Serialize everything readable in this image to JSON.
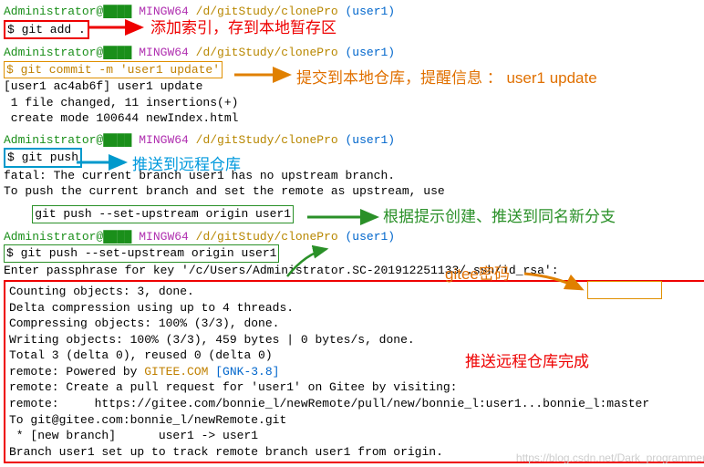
{
  "prompt": {
    "user": "Administrator@",
    "host": " MINGW64 ",
    "path": "/d/gitStudy/clonePro ",
    "branch": "(user1)",
    "blocked": "████"
  },
  "cmd": {
    "add": "$ git add .",
    "commit": "$ git commit -m 'user1 update'",
    "push": "$ git push",
    "setup": "git push --set-upstream origin user1",
    "setup2": "$ git push --set-upstream origin user1"
  },
  "out": {
    "commit1": "[user1 ac4ab6f] user1 update",
    "commit2": " 1 file changed, 11 insertions(+)",
    "commit3": " create mode 100644 newIndex.html",
    "push1": "fatal: The current branch user1 has no upstream branch.",
    "push2": "To push the current branch and set the remote as upstream, use",
    "pass": "Enter passphrase for key '/c/Users/Administrator.SC-201912251133/.ssh/id_rsa':",
    "r1": "Counting objects: 3, done.",
    "r2": "Delta compression using up to 4 threads.",
    "r3": "Compressing objects: 100% (3/3), done.",
    "r4": "Writing objects: 100% (3/3), 459 bytes | 0 bytes/s, done.",
    "r5": "Total 3 (delta 0), reused 0 (delta 0)",
    "r6a": "remote: Powered by ",
    "r6b": "GITEE.COM ",
    "r6c": "[GNK-3.8]",
    "r7": "remote: Create a pull request for 'user1' on Gitee by visiting:",
    "r8": "remote:     https://gitee.com/bonnie_l/newRemote/pull/new/bonnie_l:user1...bonnie_l:master",
    "r9": "To git@gitee.com:bonnie_l/newRemote.git",
    "r10": " * [new branch]      user1 -> user1",
    "r11": "Branch user1 set up to track remote branch user1 from origin."
  },
  "ann": {
    "a1": "添加索引，存到本地暂存区",
    "a2": "提交到本地仓库，提醒信息 ： user1 update",
    "a3": "推送到远程仓库",
    "a4": "根据提示创建、推送到同名新分支",
    "a5": "gitee密码",
    "a6": "推送远程仓库完成"
  },
  "watermark": "https://blog.csdn.net/Dark_programmer"
}
